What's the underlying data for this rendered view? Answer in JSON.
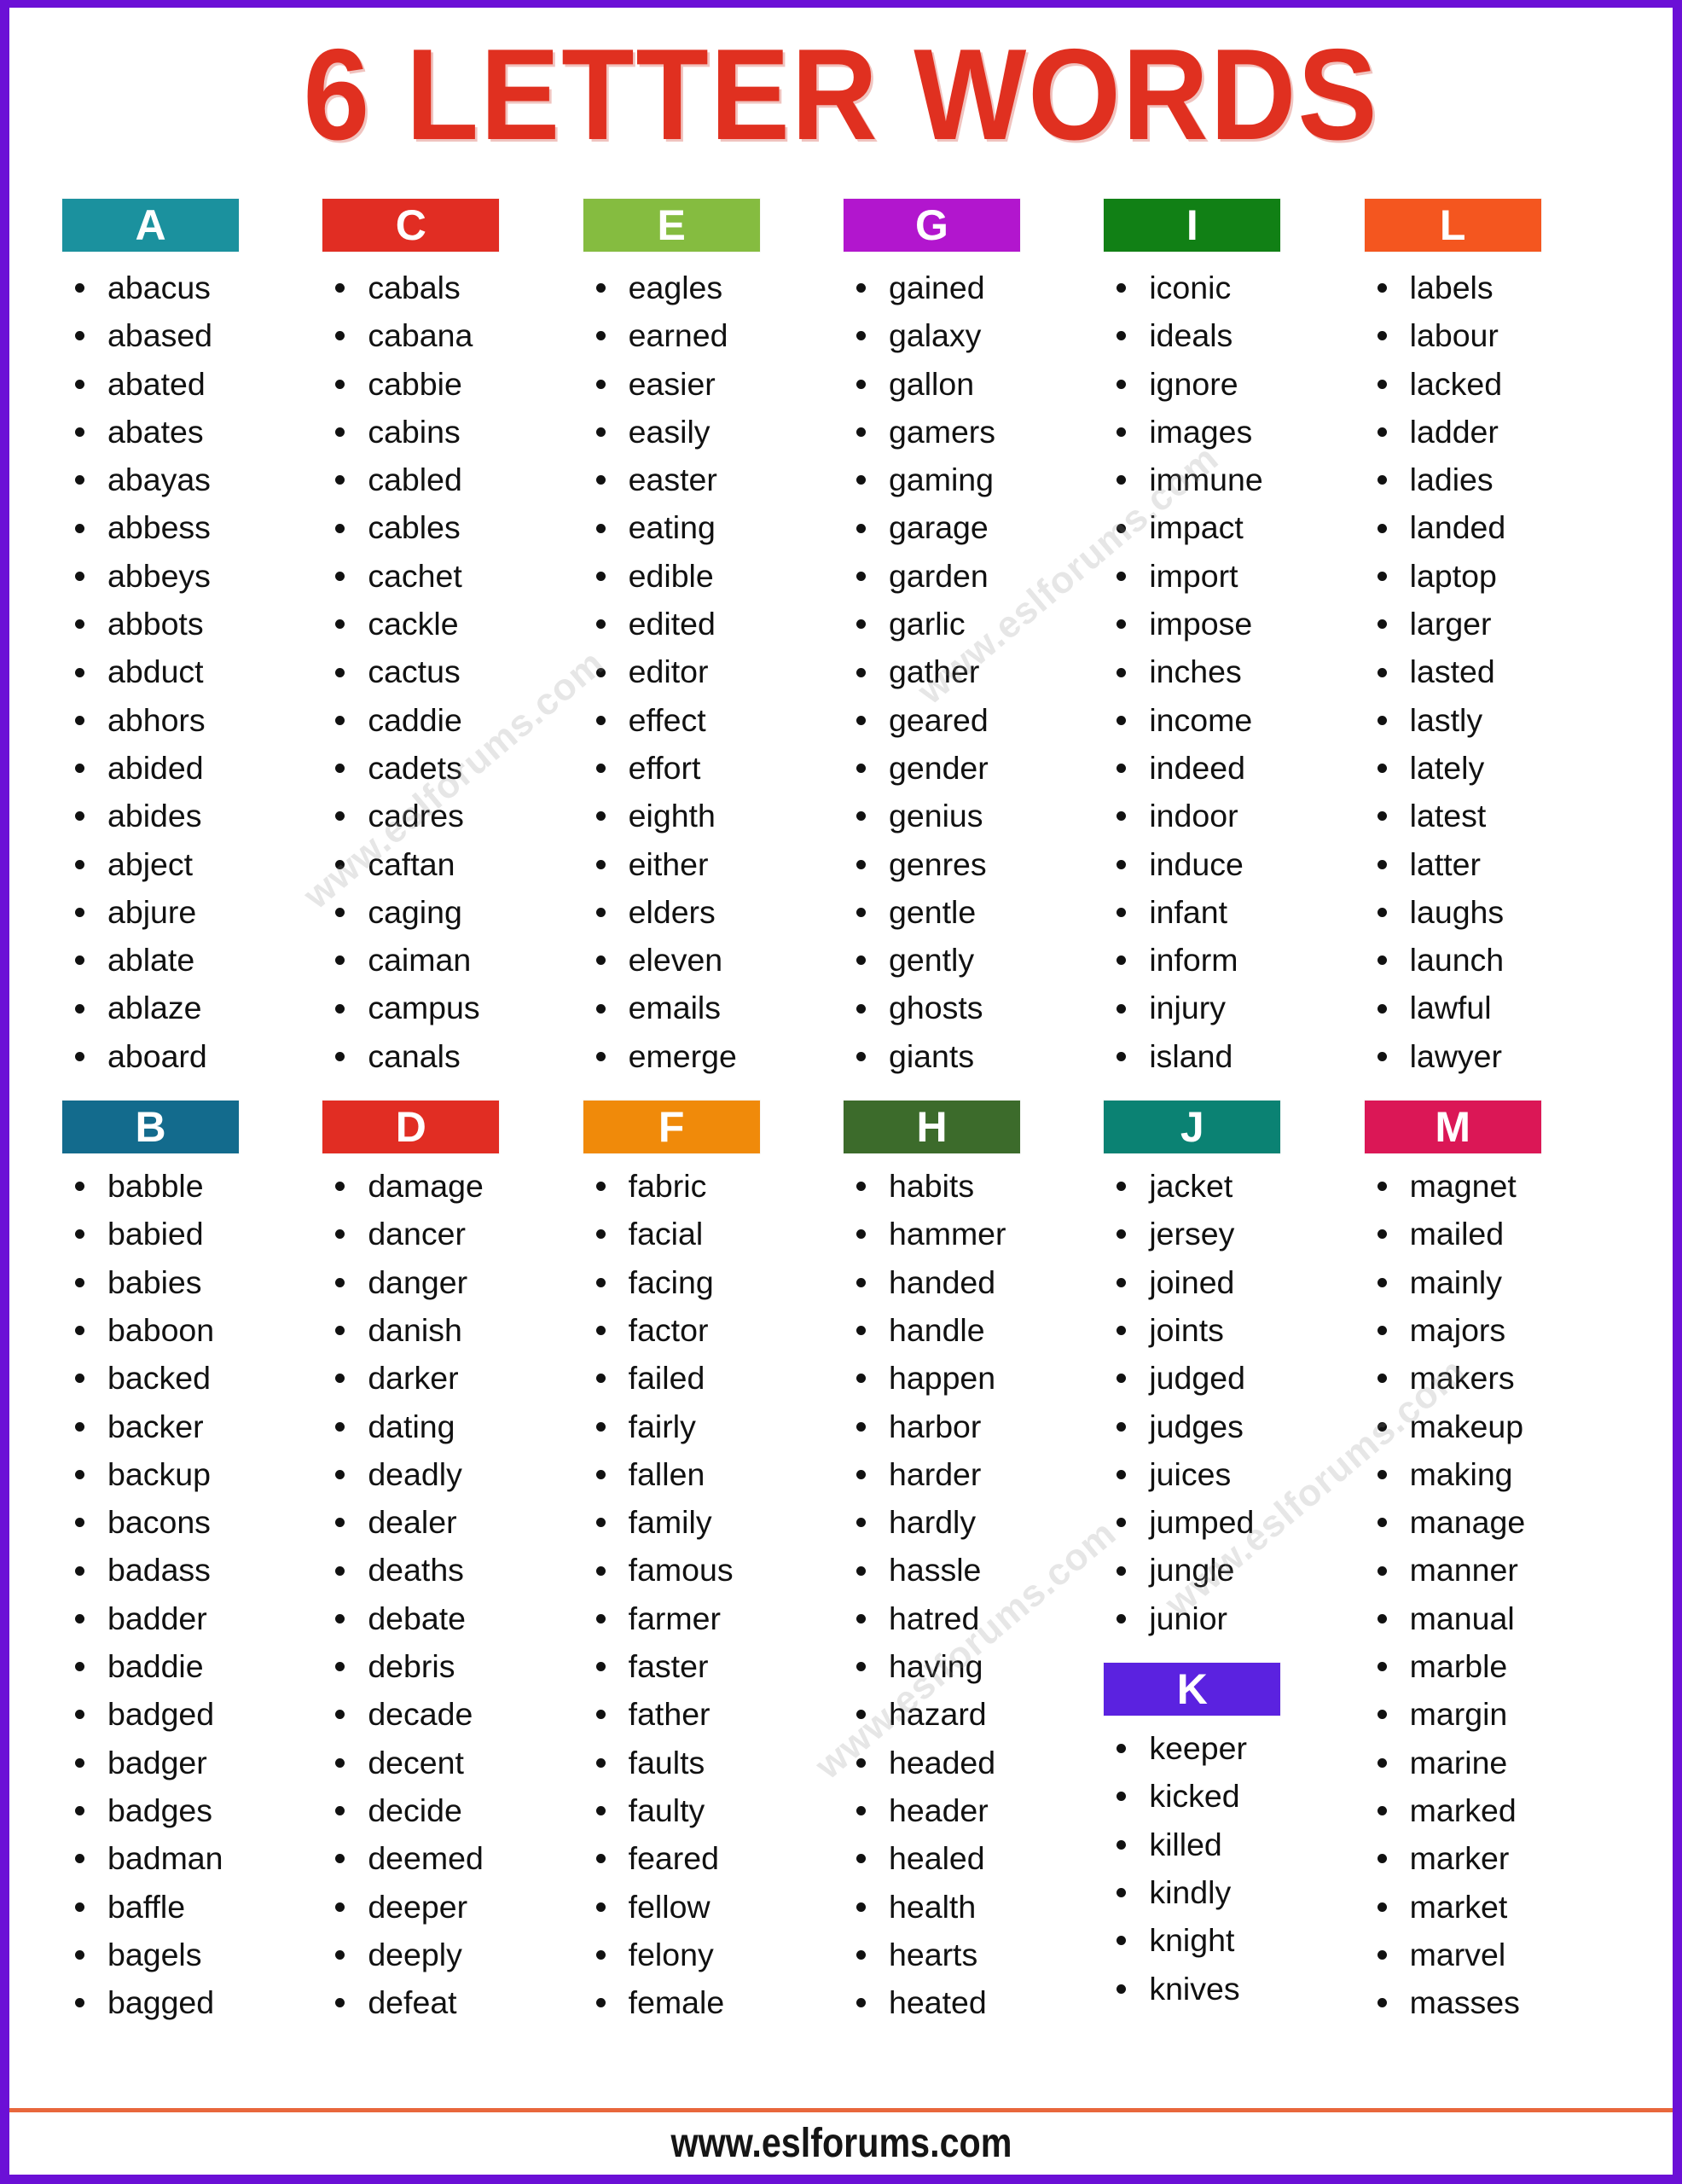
{
  "header": {
    "title": "6 LETTER WORDS"
  },
  "footer": {
    "site": "www.eslforums.com",
    "rule_color": "#E8673C"
  },
  "theme": {
    "page_border": "#6B10D6",
    "title_color": "#E03020",
    "text_color": "#111111",
    "bullet_color": "#111111"
  },
  "watermarks": [
    {
      "text": "www.eslforums.com"
    },
    {
      "text": "www.eslforums.com"
    },
    {
      "text": "www.eslforums.com"
    },
    {
      "text": "www.eslforums.com"
    }
  ],
  "columns": [
    {
      "groups": [
        {
          "letter": "A",
          "color": "#1B919E",
          "words": [
            "abacus",
            "abased",
            "abated",
            "abates",
            "abayas",
            "abbess",
            "abbeys",
            "abbots",
            "abduct",
            "abhors",
            "abided",
            "abides",
            "abject",
            "abjure",
            "ablate",
            "ablaze",
            "aboard"
          ]
        },
        {
          "letter": "B",
          "color": "#136B8D",
          "words": [
            "babble",
            "babied",
            "babies",
            "baboon",
            "backed",
            "backer",
            "backup",
            "bacons",
            "badass",
            "badder",
            "baddie",
            "badged",
            "badger",
            "badges",
            "badman",
            "baffle",
            "bagels",
            "bagged"
          ]
        }
      ]
    },
    {
      "groups": [
        {
          "letter": "C",
          "color": "#E12D23",
          "words": [
            "cabals",
            "cabana",
            "cabbie",
            "cabins",
            "cabled",
            "cables",
            "cachet",
            "cackle",
            "cactus",
            "caddie",
            "cadets",
            "cadres",
            "caftan",
            "caging",
            "caiman",
            "campus",
            "canals"
          ]
        },
        {
          "letter": "D",
          "color": "#E12D23",
          "words": [
            "damage",
            "dancer",
            "danger",
            "danish",
            "darker",
            "dating",
            "deadly",
            "dealer",
            "deaths",
            "debate",
            "debris",
            "decade",
            "decent",
            "decide",
            "deemed",
            "deeper",
            "deeply",
            "defeat"
          ]
        }
      ]
    },
    {
      "groups": [
        {
          "letter": "E",
          "color": "#85BC40",
          "words": [
            "eagles",
            "earned",
            "easier",
            "easily",
            "easter",
            "eating",
            "edible",
            "edited",
            "editor",
            "effect",
            "effort",
            "eighth",
            "either",
            "elders",
            "eleven",
            "emails",
            "emerge"
          ]
        },
        {
          "letter": "F",
          "color": "#F08A0A",
          "words": [
            "fabric",
            "facial",
            "facing",
            "factor",
            "failed",
            "fairly",
            "fallen",
            "family",
            "famous",
            "farmer",
            "faster",
            "father",
            "faults",
            "faulty",
            "feared",
            "fellow",
            "felony",
            "female"
          ]
        }
      ]
    },
    {
      "groups": [
        {
          "letter": "G",
          "color": "#B216CE",
          "words": [
            "gained",
            "galaxy",
            "gallon",
            "gamers",
            "gaming",
            "garage",
            "garden",
            "garlic",
            "gather",
            "geared",
            "gender",
            "genius",
            "genres",
            "gentle",
            "gently",
            "ghosts",
            "giants"
          ]
        },
        {
          "letter": "H",
          "color": "#3C6B2B",
          "words": [
            "habits",
            "hammer",
            "handed",
            "handle",
            "happen",
            "harbor",
            "harder",
            "hardly",
            "hassle",
            "hatred",
            "having",
            "hazard",
            "headed",
            "header",
            "healed",
            "health",
            "hearts",
            "heated"
          ]
        }
      ]
    },
    {
      "groups": [
        {
          "letter": "I",
          "color": "#118015",
          "words": [
            "iconic",
            "ideals",
            "ignore",
            "images",
            "immune",
            "impact",
            "import",
            "impose",
            "inches",
            "income",
            "indeed",
            "indoor",
            "induce",
            "infant",
            "inform",
            "injury",
            "island"
          ]
        },
        {
          "letter": "J",
          "color": "#0B8273",
          "words": [
            "jacket",
            "jersey",
            "joined",
            "joints",
            "judged",
            "judges",
            "juices",
            "jumped",
            "jungle",
            "junior"
          ]
        },
        {
          "letter": "K",
          "color": "#5B22E0",
          "words": [
            "keeper",
            "kicked",
            "killed",
            "kindly",
            "knight",
            "knives"
          ]
        }
      ]
    },
    {
      "groups": [
        {
          "letter": "L",
          "color": "#F4561F",
          "words": [
            "labels",
            "labour",
            "lacked",
            "ladder",
            "ladies",
            "landed",
            "laptop",
            "larger",
            "lasted",
            "lastly",
            "lately",
            "latest",
            "latter",
            "laughs",
            "launch",
            "lawful",
            "lawyer"
          ]
        },
        {
          "letter": "M",
          "color": "#DB1756",
          "words": [
            "magnet",
            "mailed",
            "mainly",
            "majors",
            "makers",
            "makeup",
            "making",
            "manage",
            "manner",
            "manual",
            "marble",
            "margin",
            "marine",
            "marked",
            "marker",
            "market",
            "marvel",
            "masses"
          ]
        }
      ]
    }
  ]
}
